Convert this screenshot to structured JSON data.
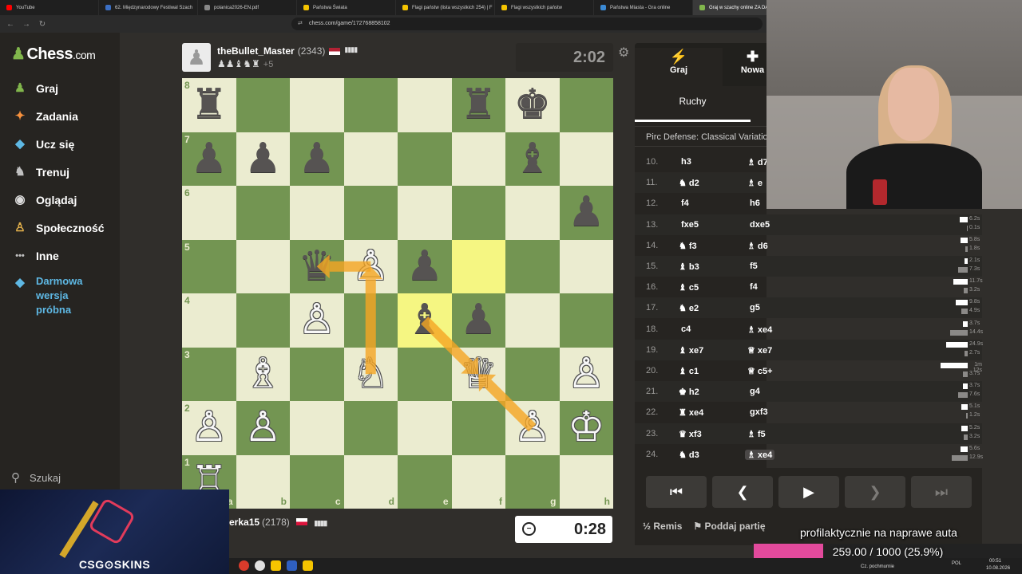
{
  "browser": {
    "tabs": [
      {
        "label": "YouTube",
        "color": "#ff0000",
        "active": false
      },
      {
        "label": "62. Międzynarodowy Festiwal Szach",
        "color": "#3b6fc4",
        "active": false
      },
      {
        "label": "polanica2026-EN.pdf",
        "color": "#888888",
        "active": false
      },
      {
        "label": "Państwa Świata",
        "color": "#f5c400",
        "active": false
      },
      {
        "label": "Flagi państw (lista wszystkich 254) | F",
        "color": "#f5c400",
        "active": false
      },
      {
        "label": "Flagi wszystkich państw",
        "color": "#f5c400",
        "active": false
      },
      {
        "label": "Państwa Miasta - Gra online",
        "color": "#3b8ad4",
        "active": false
      },
      {
        "label": "Graj w szachy online ZA DARM",
        "color": "#81b64c",
        "active": true
      }
    ],
    "url": "chess.com/game/172768858102"
  },
  "sidebar": {
    "logo_main": "Chess",
    "logo_suffix": ".com",
    "items": [
      {
        "label": "Graj",
        "icon": "play-icon"
      },
      {
        "label": "Zadania",
        "icon": "puzzle-icon"
      },
      {
        "label": "Ucz się",
        "icon": "learn-icon"
      },
      {
        "label": "Trenuj",
        "icon": "train-icon"
      },
      {
        "label": "Oglądaj",
        "icon": "watch-icon"
      },
      {
        "label": "Społeczność",
        "icon": "community-icon"
      },
      {
        "label": "Inne",
        "icon": "more-icon"
      }
    ],
    "promo": "Darmowa wersja próbna",
    "search": "Szukaj"
  },
  "top_player": {
    "name": "theBullet_Master",
    "rating": "(2343)",
    "captured": "♟♟♝♞♜",
    "advantage": "+5",
    "clock": "2:02"
  },
  "bottom_player": {
    "name": "erka15",
    "rating": "(2178)",
    "clock": "0:28"
  },
  "board": {
    "ranks": [
      "8",
      "7",
      "6",
      "5",
      "4",
      "3",
      "2",
      "1"
    ],
    "files": [
      "a",
      "b",
      "c",
      "d",
      "e",
      "f",
      "g",
      "h"
    ],
    "highlight": [
      "f5",
      "e4"
    ],
    "pieces": [
      {
        "sq": "a8",
        "p": "♜",
        "c": "b"
      },
      {
        "sq": "f8",
        "p": "♜",
        "c": "b"
      },
      {
        "sq": "g8",
        "p": "♚",
        "c": "b"
      },
      {
        "sq": "a7",
        "p": "♟",
        "c": "b"
      },
      {
        "sq": "b7",
        "p": "♟",
        "c": "b"
      },
      {
        "sq": "c7",
        "p": "♟",
        "c": "b"
      },
      {
        "sq": "g7",
        "p": "♝",
        "c": "b"
      },
      {
        "sq": "h6",
        "p": "♟",
        "c": "b"
      },
      {
        "sq": "c5",
        "p": "♛",
        "c": "b"
      },
      {
        "sq": "d5",
        "p": "♙",
        "c": "w"
      },
      {
        "sq": "e5",
        "p": "♟",
        "c": "b"
      },
      {
        "sq": "c4",
        "p": "♙",
        "c": "w"
      },
      {
        "sq": "e4",
        "p": "♝",
        "c": "b"
      },
      {
        "sq": "f4",
        "p": "♟",
        "c": "b"
      },
      {
        "sq": "b3",
        "p": "♗",
        "c": "w"
      },
      {
        "sq": "d3",
        "p": "♘",
        "c": "w"
      },
      {
        "sq": "f3",
        "p": "♕",
        "c": "w"
      },
      {
        "sq": "h3",
        "p": "♙",
        "c": "w"
      },
      {
        "sq": "a2",
        "p": "♙",
        "c": "w"
      },
      {
        "sq": "b2",
        "p": "♙",
        "c": "w"
      },
      {
        "sq": "g2",
        "p": "♙",
        "c": "w"
      },
      {
        "sq": "h2",
        "p": "♔",
        "c": "w"
      },
      {
        "sq": "a1",
        "p": "♖",
        "c": "w"
      }
    ],
    "arrows": [
      {
        "from": "d3",
        "to": "d5"
      },
      {
        "from": "d5",
        "to": "c5"
      },
      {
        "from": "g2",
        "to": "f3"
      },
      {
        "from": "e4",
        "to": "f3"
      }
    ]
  },
  "right_panel": {
    "nav_play": "Graj",
    "nav_new": "Nowa",
    "moves_tab": "Ruchy",
    "opening": "Pirc Defense: Classical Variation",
    "moves": [
      {
        "n": "10.",
        "w": "h3",
        "wp": "",
        "b": "d7",
        "bp": "♗",
        "t1": "",
        "t2": "",
        "b1": 0,
        "b2": 0
      },
      {
        "n": "11.",
        "w": "d2",
        "wp": "♞",
        "b": "e",
        "bp": "♗",
        "t1": "",
        "t2": "",
        "b1": 0,
        "b2": 0
      },
      {
        "n": "12.",
        "w": "f4",
        "wp": "",
        "b": "h6",
        "bp": "",
        "t1": "",
        "t2": "",
        "b1": 0,
        "b2": 0
      },
      {
        "n": "13.",
        "w": "fxe5",
        "wp": "",
        "b": "dxe5",
        "bp": "",
        "t1": "6.2s",
        "t2": "0.1s",
        "b1": 10,
        "b2": 1
      },
      {
        "n": "14.",
        "w": "f3",
        "wp": "♞",
        "b": "d6",
        "bp": "♗",
        "t1": "5.8s",
        "t2": "1.8s",
        "b1": 9,
        "b2": 3
      },
      {
        "n": "15.",
        "w": "b3",
        "wp": "♝",
        "b": "f5",
        "bp": "",
        "t1": "2.1s",
        "t2": "7.3s",
        "b1": 4,
        "b2": 12
      },
      {
        "n": "16.",
        "w": "c5",
        "wp": "♝",
        "b": "f4",
        "bp": "",
        "t1": "11.7s",
        "t2": "3.2s",
        "b1": 18,
        "b2": 5
      },
      {
        "n": "17.",
        "w": "e2",
        "wp": "♞",
        "b": "g5",
        "bp": "",
        "t1": "9.8s",
        "t2": "4.9s",
        "b1": 15,
        "b2": 8
      },
      {
        "n": "18.",
        "w": "c4",
        "wp": "",
        "b": "xe4",
        "bp": "♗",
        "t1": "3.7s",
        "t2": "14.4s",
        "b1": 6,
        "b2": 22
      },
      {
        "n": "19.",
        "w": "xe7",
        "wp": "♝",
        "b": "xe7",
        "bp": "♕",
        "t1": "24.9s",
        "t2": "2.7s",
        "b1": 27,
        "b2": 4
      },
      {
        "n": "20.",
        "w": "c1",
        "wp": "♝",
        "b": "c5+",
        "bp": "♕",
        "t1": "1m 12s",
        "t2": "3.7s",
        "b1": 34,
        "b2": 6
      },
      {
        "n": "21.",
        "w": "h2",
        "wp": "♚",
        "b": "g4",
        "bp": "",
        "t1": "3.7s",
        "t2": "7.6s",
        "b1": 6,
        "b2": 12
      },
      {
        "n": "22.",
        "w": "xe4",
        "wp": "♜",
        "b": "gxf3",
        "bp": "",
        "t1": "5.1s",
        "t2": "1.2s",
        "b1": 8,
        "b2": 2
      },
      {
        "n": "23.",
        "w": "xf3",
        "wp": "♛",
        "b": "f5",
        "bp": "♗",
        "t1": "5.2s",
        "t2": "3.2s",
        "b1": 8,
        "b2": 5
      },
      {
        "n": "24.",
        "w": "d3",
        "wp": "♞",
        "b": "xe4",
        "bp": "♗",
        "t1": "5.6s",
        "t2": "12.9s",
        "b1": 9,
        "b2": 20
      }
    ],
    "controls": [
      "⏮",
      "❮",
      "▶",
      "❯",
      "⏭"
    ],
    "remis": "Remis",
    "resign": "Poddaj partię"
  },
  "stream": {
    "overlay": "profilaktycznie na naprawe auta",
    "goal_text": "259.00 / 1000 (25.9%)",
    "goal_fraction": 0.259,
    "sponsor": "CSG⊙SKINS",
    "clock_time": "00:51",
    "clock_date": "10.08.2026",
    "weather": "Cz. pochmurnie",
    "lang": "POL"
  }
}
